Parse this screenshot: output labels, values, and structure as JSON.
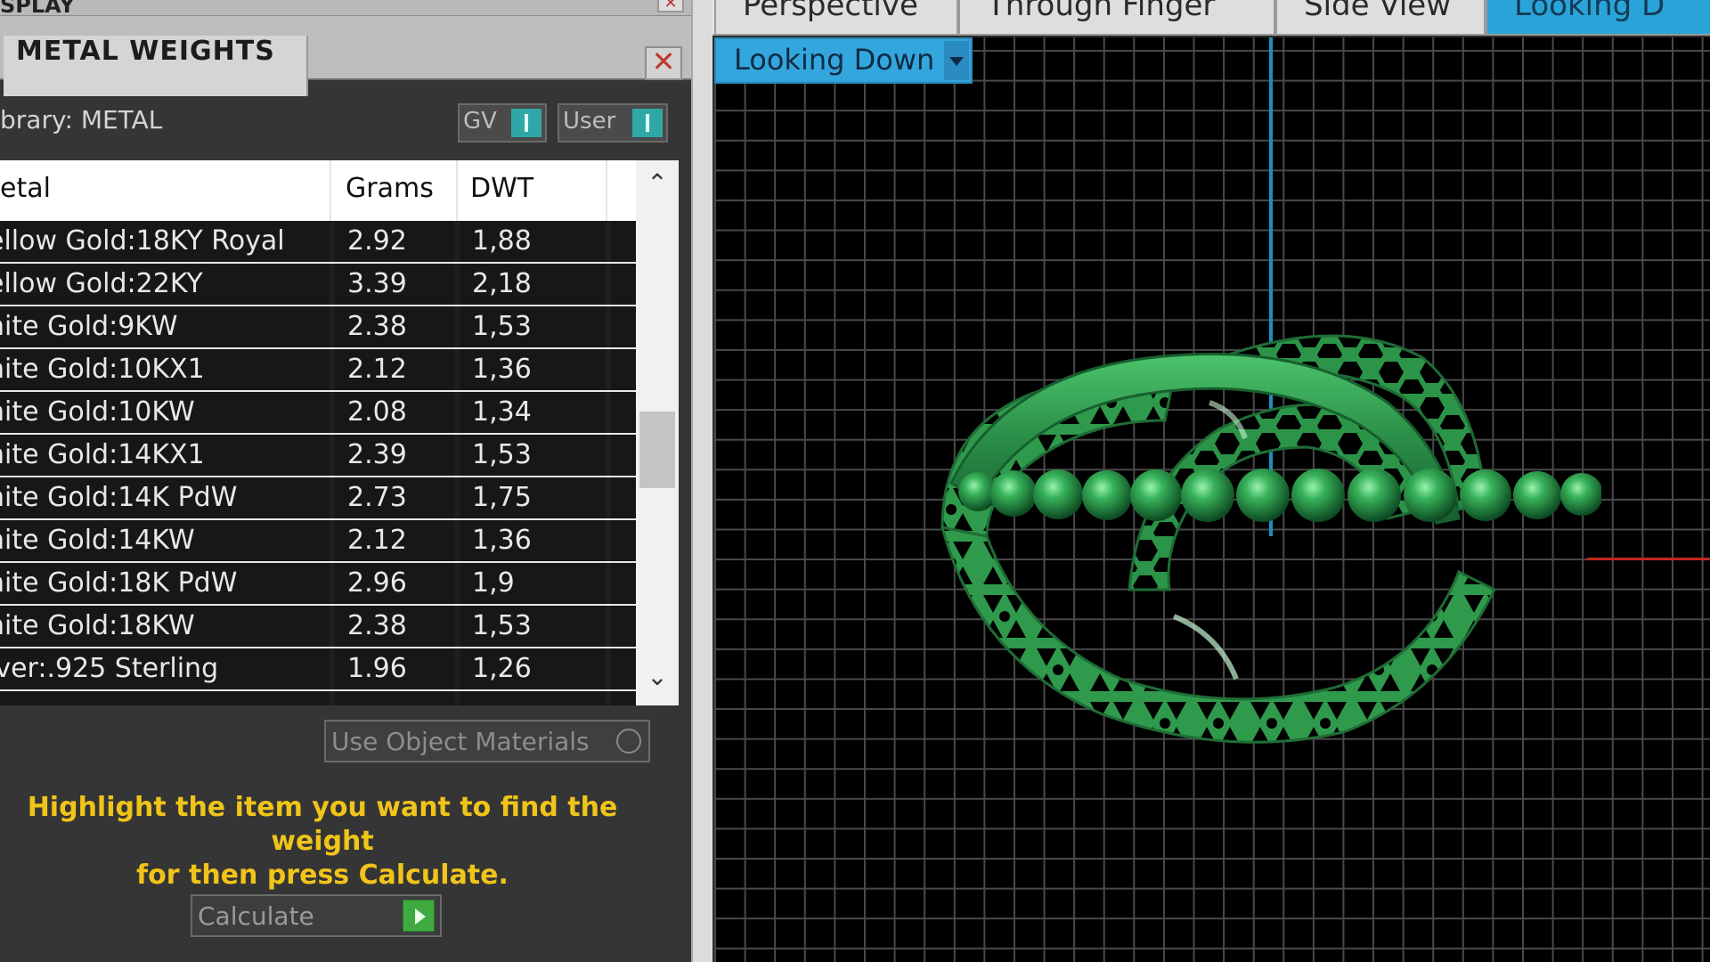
{
  "left_panel": {
    "top_title": "SPLAY",
    "top_close": "✕",
    "tab_title": "METAL WEIGHTS",
    "close_glyph": "✕",
    "library_label": "brary: METAL",
    "toggles": [
      {
        "label": "GV"
      },
      {
        "label": "User"
      }
    ],
    "table": {
      "headers": [
        "etal",
        "Grams",
        "DWT"
      ],
      "rows": [
        {
          "metal": "ellow Gold:18KY Royal",
          "grams": "2.92",
          "dwt": "1,88"
        },
        {
          "metal": "ellow Gold:22KY",
          "grams": "3.39",
          "dwt": "2,18"
        },
        {
          "metal": "hite Gold:9KW",
          "grams": "2.38",
          "dwt": "1,53"
        },
        {
          "metal": "hite Gold:10KX1",
          "grams": "2.12",
          "dwt": "1,36"
        },
        {
          "metal": "hite Gold:10KW",
          "grams": "2.08",
          "dwt": "1,34"
        },
        {
          "metal": "hite Gold:14KX1",
          "grams": "2.39",
          "dwt": "1,53"
        },
        {
          "metal": "hite Gold:14K PdW",
          "grams": "2.73",
          "dwt": "1,75"
        },
        {
          "metal": "hite Gold:14KW",
          "grams": "2.12",
          "dwt": "1,36"
        },
        {
          "metal": "hite Gold:18K PdW",
          "grams": "2.96",
          "dwt": "1,9"
        },
        {
          "metal": "hite Gold:18KW",
          "grams": "2.38",
          "dwt": "1,53"
        },
        {
          "metal": "lver:.925 Sterling",
          "grams": "1.96",
          "dwt": "1,26"
        }
      ],
      "scroll_up_icon": "chevron-up-icon",
      "scroll_down_icon": "chevron-down-icon"
    },
    "use_object_materials": "Use Object Materials",
    "hint_line1": "Highlight the item you want to find the weight",
    "hint_line2": "for then press Calculate.",
    "calculate_label": "Calculate"
  },
  "viewport": {
    "tabs": [
      "Perspective",
      "Through Finger",
      "Side View",
      "Looking D"
    ],
    "active_tab_index": 3,
    "view_selector": "Looking Down"
  },
  "colors": {
    "accent": "#2aa4d8",
    "hint_text": "#f0c419",
    "model_green": "#2f9a4c",
    "axis_vertical": "#1c8fbf",
    "axis_horizontal": "#c0281f"
  }
}
